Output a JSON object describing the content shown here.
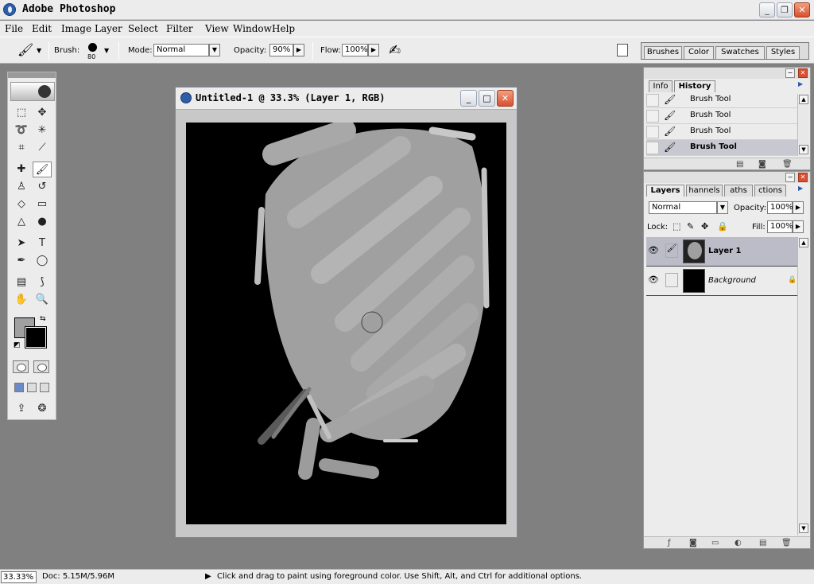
{
  "app": {
    "title": "Adobe Photoshop"
  },
  "menu": [
    "File",
    "Edit",
    "Image",
    "Layer",
    "Select",
    "Filter",
    "View",
    "Window",
    "Help"
  ],
  "options": {
    "brush_label": "Brush:",
    "brush_size": "80",
    "mode_label": "Mode:",
    "mode_value": "Normal",
    "opacity_label": "Opacity:",
    "opacity_value": "90%",
    "flow_label": "Flow:",
    "flow_value": "100%"
  },
  "palette_well": [
    "Brushes",
    "Color",
    "Swatches",
    "Styles"
  ],
  "document": {
    "title": "Untitled-1 @ 33.3% (Layer 1, RGB)"
  },
  "history_panel": {
    "tabs": [
      "Info",
      "History"
    ],
    "active_tab": "History",
    "items": [
      "Brush Tool",
      "Brush Tool",
      "Brush Tool",
      "Brush Tool"
    ],
    "current_index": 3
  },
  "layers_panel": {
    "tabs": [
      "Layers",
      "Channels",
      "Paths",
      "Actions"
    ],
    "tab_display": [
      "Layers",
      "hannels",
      "aths",
      "ctions"
    ],
    "blend_mode": "Normal",
    "opacity_label": "Opacity:",
    "opacity_value": "100%",
    "lock_label": "Lock:",
    "fill_label": "Fill:",
    "fill_value": "100%",
    "layers": [
      {
        "name": "Layer 1",
        "visible": true,
        "selected": true
      },
      {
        "name": "Background",
        "visible": true,
        "selected": false,
        "locked": true
      }
    ]
  },
  "status": {
    "zoom": "33.33%",
    "doc": "Doc: 5.15M/5.96M",
    "hint": "Click and drag to paint using foreground color.  Use Shift, Alt, and Ctrl for additional options."
  },
  "colors": {
    "foreground": "#a0a0a0",
    "background": "#000000",
    "workspace": "#808080",
    "accent": "#2e5ea8"
  }
}
